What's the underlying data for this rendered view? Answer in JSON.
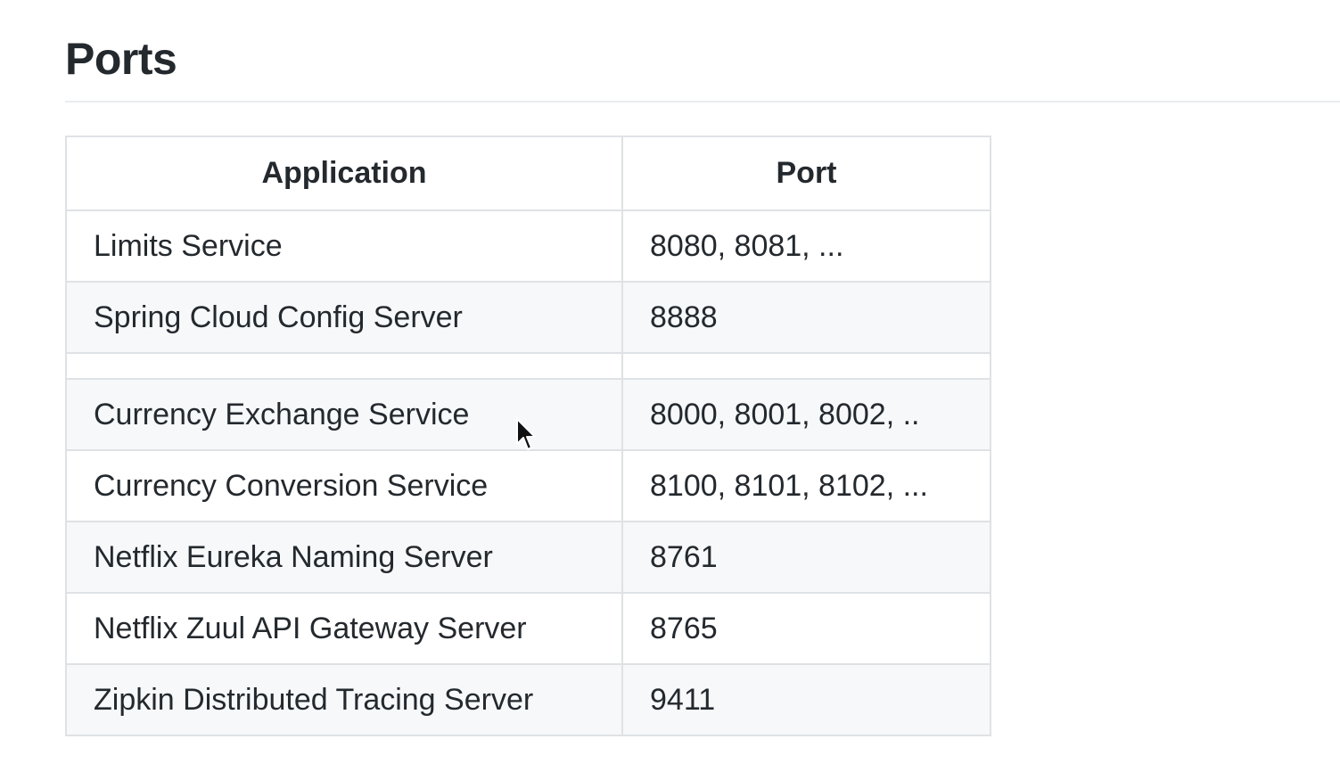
{
  "page": {
    "title": "Ports"
  },
  "table": {
    "headers": {
      "application": "Application",
      "port": "Port"
    },
    "rows": [
      {
        "application": "Limits Service",
        "port": "8080, 8081, ..."
      },
      {
        "application": "Spring Cloud Config Server",
        "port": "8888"
      },
      {
        "application": "",
        "port": ""
      },
      {
        "application": "Currency Exchange Service",
        "port": "8000, 8001, 8002, .."
      },
      {
        "application": "Currency Conversion Service",
        "port": "8100, 8101, 8102, ..."
      },
      {
        "application": "Netflix Eureka Naming Server",
        "port": "8761"
      },
      {
        "application": "Netflix Zuul API Gateway Server",
        "port": "8765"
      },
      {
        "application": "Zipkin Distributed Tracing Server",
        "port": "9411"
      }
    ]
  },
  "colors": {
    "text": "#24292e",
    "border": "#dfe2e5",
    "stripe": "#f6f8fa",
    "rule": "#eaecef"
  },
  "icons": {
    "cursor": "mouse-pointer-icon"
  }
}
